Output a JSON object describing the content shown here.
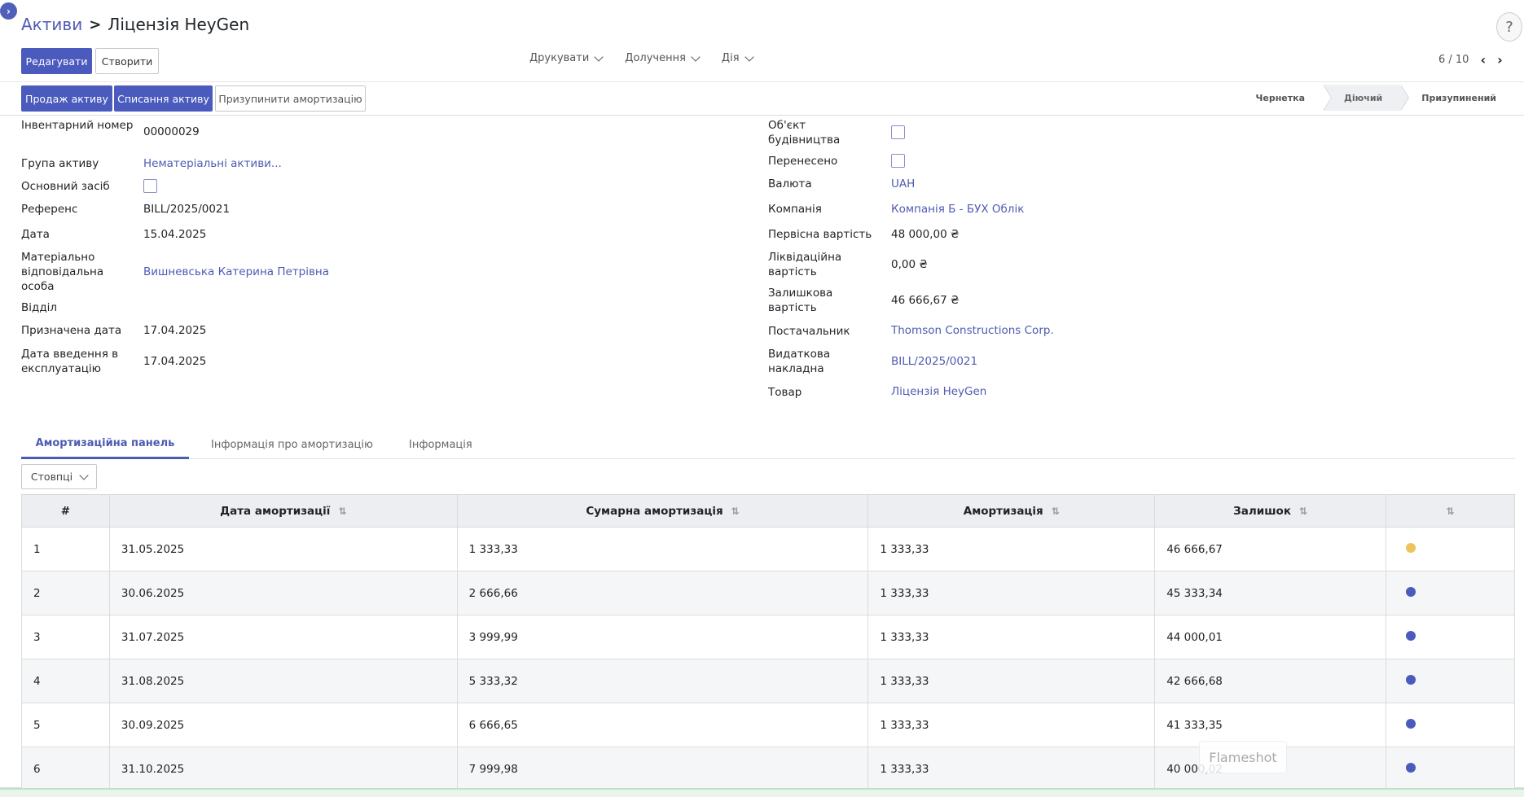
{
  "breadcrumb": {
    "parent": "Активи",
    "current": "Ліцензія HeyGen"
  },
  "toolbar": {
    "edit": "Редагувати",
    "create": "Створити"
  },
  "menus": {
    "print": "Друкувати",
    "attachments": "Долучення",
    "action": "Дія"
  },
  "pager": {
    "text": "6 / 10"
  },
  "actions": {
    "sell": "Продаж активу",
    "dispose": "Списання активу",
    "pause": "Призупинити амортизацію"
  },
  "stages": [
    "Чернетка",
    "Діючий",
    "Призупинений"
  ],
  "left_fields": {
    "inventory_label": "Інвентарний номер",
    "inventory_value": "00000029",
    "group_label": "Група активу",
    "group_value": "Нематеріальні активи...",
    "fixed_label": "Основний засіб",
    "ref_label": "Референс",
    "ref_value": "BILL/2025/0021",
    "date_label": "Дата",
    "date_value": "15.04.2025",
    "person_label": "Матеріально відповідальна особа",
    "person_value": "Вишневська Катерина Петрівна",
    "dept_label": "Відділ",
    "assigned_label": "Призначена дата",
    "assigned_value": "17.04.2025",
    "commission_label": "Дата введення в експлуатацію",
    "commission_value": "17.04.2025"
  },
  "right_fields": {
    "construction_label": "Об'єкт будівництва",
    "transferred_label": "Перенесено",
    "currency_label": "Валюта",
    "currency_value": "UAH",
    "company_label": "Компанія",
    "company_value": "Компанія Б - БУХ Облік",
    "initial_label": "Первісна вартість",
    "initial_value": "48 000,00 ₴",
    "salvage_label": "Ліквідаційна вартість",
    "salvage_value": "0,00 ₴",
    "residual_label": "Залишкова вартість",
    "residual_value": "46 666,67 ₴",
    "vendor_label": "Постачальник",
    "vendor_value": "Thomson Constructions Corp.",
    "bill_label": "Видаткова накладна",
    "bill_value": "BILL/2025/0021",
    "product_label": "Товар",
    "product_value": "Ліцензія HeyGen"
  },
  "tabs": [
    "Амортизаційна панель",
    "Інформація про амортизацію",
    "Інформація"
  ],
  "columns_button": "Стовпці",
  "table": {
    "headers": [
      "#",
      "Дата амортизації",
      "Сумарна амортизація",
      "Амортизація",
      "Залишок"
    ],
    "rows": [
      {
        "n": "1",
        "date": "31.05.2025",
        "cum": "1 333,33",
        "dep": "1 333,33",
        "rem": "46 666,67",
        "color": "#f0c35a"
      },
      {
        "n": "2",
        "date": "30.06.2025",
        "cum": "2 666,66",
        "dep": "1 333,33",
        "rem": "45 333,34",
        "color": "#4b5bbd"
      },
      {
        "n": "3",
        "date": "31.07.2025",
        "cum": "3 999,99",
        "dep": "1 333,33",
        "rem": "44 000,01",
        "color": "#4b5bbd"
      },
      {
        "n": "4",
        "date": "31.08.2025",
        "cum": "5 333,32",
        "dep": "1 333,33",
        "rem": "42 666,68",
        "color": "#4b5bbd"
      },
      {
        "n": "5",
        "date": "30.09.2025",
        "cum": "6 666,65",
        "dep": "1 333,33",
        "rem": "41 333,35",
        "color": "#4b5bbd"
      },
      {
        "n": "6",
        "date": "31.10.2025",
        "cum": "7 999,98",
        "dep": "1 333,33",
        "rem": "40 000,02",
        "color": "#4b5bbd"
      }
    ]
  },
  "overlay": {
    "text": "Flameshot"
  }
}
